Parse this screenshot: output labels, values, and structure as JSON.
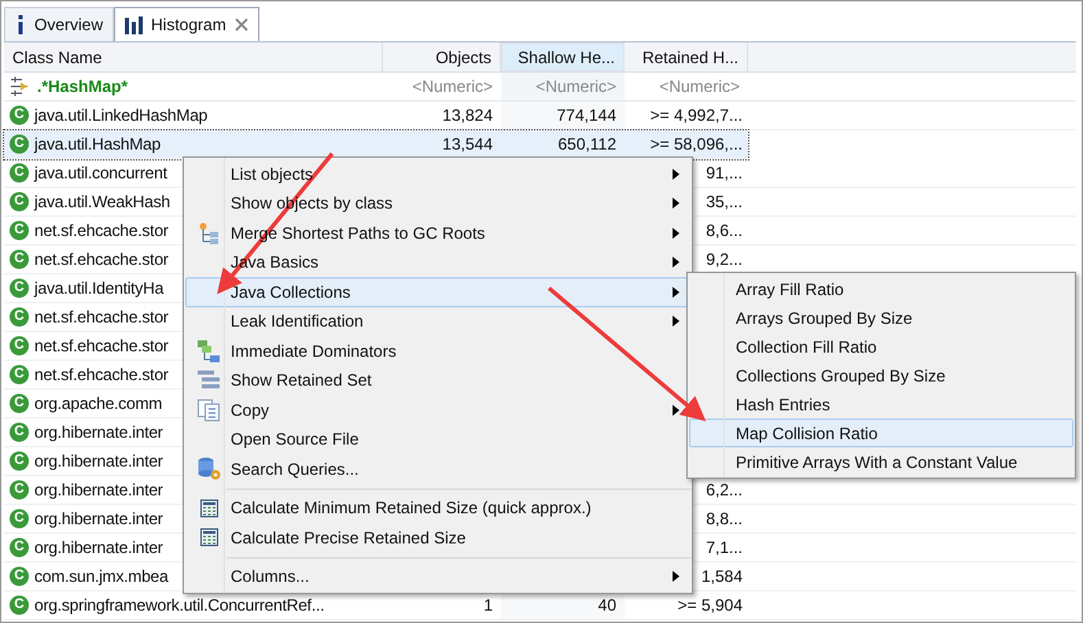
{
  "tabs": [
    {
      "label": "Overview",
      "selected": false,
      "closable": false
    },
    {
      "label": "Histogram",
      "selected": true,
      "closable": true
    }
  ],
  "table": {
    "columns": [
      {
        "label": "Class Name",
        "selected": false
      },
      {
        "label": "Objects",
        "selected": false
      },
      {
        "label": "Shallow He...",
        "selected": true
      },
      {
        "label": "Retained H...",
        "selected": false
      }
    ],
    "filter": {
      "pattern": ".*HashMap*",
      "numeric": [
        "<Numeric>",
        "<Numeric>",
        "<Numeric>"
      ]
    },
    "rows": [
      {
        "badge": "C",
        "name": "java.util.LinkedHashMap",
        "objects": "13,824",
        "shallow": "774,144",
        "retained": ">= 4,992,7...",
        "selected": false
      },
      {
        "badge": "C",
        "name": "java.util.HashMap",
        "objects": "13,544",
        "shallow": "650,112",
        "retained": ">= 58,096,...",
        "selected": true
      },
      {
        "badge": "C",
        "name": "java.util.concurrent",
        "retained": "91,...",
        "selected": false
      },
      {
        "badge": "C",
        "name": "java.util.WeakHash",
        "retained": "35,...",
        "selected": false
      },
      {
        "badge": "C",
        "name": "net.sf.ehcache.stor",
        "retained": "8,6...",
        "selected": false
      },
      {
        "badge": "C",
        "name": "net.sf.ehcache.stor",
        "retained": "9,2...",
        "selected": false
      },
      {
        "badge": "C",
        "name": "java.util.IdentityHa",
        "selected": false
      },
      {
        "badge": "C",
        "name": "net.sf.ehcache.stor",
        "selected": false
      },
      {
        "badge": "C",
        "name": "net.sf.ehcache.stor",
        "selected": false
      },
      {
        "badge": "C",
        "name": "net.sf.ehcache.stor",
        "selected": false
      },
      {
        "badge": "C",
        "name": "org.apache.comm",
        "selected": false
      },
      {
        "badge": "C",
        "name": "org.hibernate.inter",
        "selected": false
      },
      {
        "badge": "C",
        "name": "org.hibernate.inter",
        "selected": false
      },
      {
        "badge": "C",
        "name": "org.hibernate.inter",
        "retained": "6,2...",
        "selected": false
      },
      {
        "badge": "C",
        "name": "org.hibernate.inter",
        "retained": "8,8...",
        "selected": false
      },
      {
        "badge": "C",
        "name": "org.hibernate.inter",
        "retained": "7,1...",
        "selected": false
      },
      {
        "badge": "C",
        "name": "com.sun.jmx.mbea",
        "retained": "1,584",
        "selected": false
      },
      {
        "badge": "C",
        "name": "org.springframework.util.ConcurrentRef...",
        "objects": "1",
        "shallow": "40",
        "retained": ">= 5,904",
        "selected": false
      }
    ]
  },
  "context_menu": {
    "items": [
      {
        "kind": "item",
        "label": "List objects",
        "submenu": true,
        "selected": false
      },
      {
        "kind": "item",
        "label": "Show objects by class",
        "submenu": true,
        "selected": false
      },
      {
        "kind": "item",
        "label": "Merge Shortest Paths to GC Roots",
        "submenu": true,
        "selected": false
      },
      {
        "kind": "item",
        "label": "Java Basics",
        "submenu": true,
        "selected": false
      },
      {
        "kind": "item",
        "label": "Java Collections",
        "submenu": true,
        "selected": true
      },
      {
        "kind": "item",
        "label": "Leak Identification",
        "submenu": true,
        "selected": false
      },
      {
        "kind": "item",
        "label": "Immediate Dominators",
        "submenu": false,
        "selected": false
      },
      {
        "kind": "item",
        "label": "Show Retained Set",
        "submenu": false,
        "selected": false
      },
      {
        "kind": "item",
        "label": "Copy",
        "submenu": true,
        "selected": false
      },
      {
        "kind": "item",
        "label": "Open Source File",
        "submenu": false,
        "selected": false
      },
      {
        "kind": "item",
        "label": "Search Queries...",
        "submenu": false,
        "selected": false
      },
      {
        "kind": "separator"
      },
      {
        "kind": "item",
        "label": "Calculate Minimum Retained Size (quick approx.)",
        "submenu": false,
        "selected": false
      },
      {
        "kind": "item",
        "label": "Calculate Precise Retained Size",
        "submenu": false,
        "selected": false
      },
      {
        "kind": "separator"
      },
      {
        "kind": "item",
        "label": "Columns...",
        "submenu": true,
        "selected": false
      }
    ]
  },
  "submenu": {
    "items": [
      {
        "label": "Array Fill Ratio",
        "selected": false
      },
      {
        "label": "Arrays Grouped By Size",
        "selected": false
      },
      {
        "label": "Collection Fill Ratio",
        "selected": false
      },
      {
        "label": "Collections Grouped By Size",
        "selected": false
      },
      {
        "label": "Hash Entries",
        "selected": false
      },
      {
        "label": "Map Collision Ratio",
        "selected": true
      },
      {
        "label": "Primitive Arrays With a Constant Value",
        "selected": false
      }
    ]
  }
}
